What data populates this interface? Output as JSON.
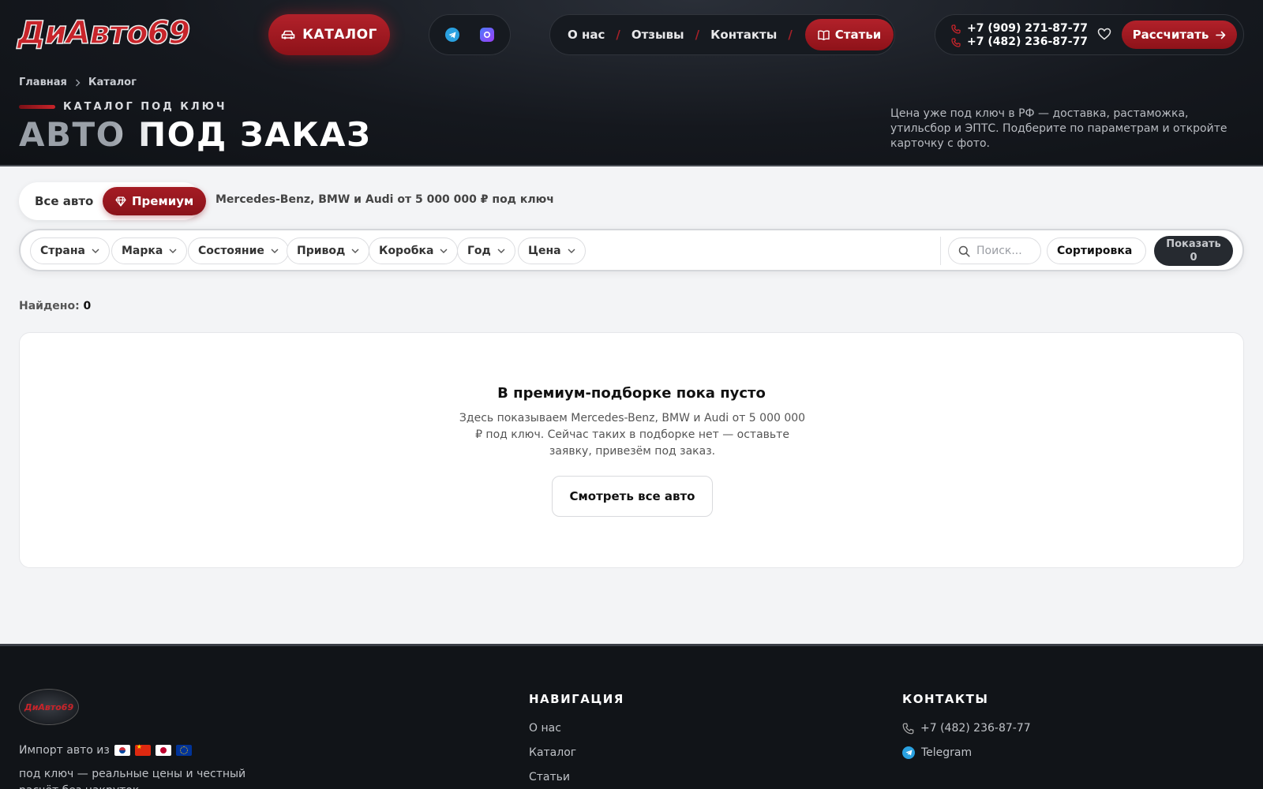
{
  "header": {
    "logo_text": "ДиАвто69",
    "catalog_button": "КАТАЛОГ",
    "social": [
      {
        "icon": "telegram-icon"
      },
      {
        "icon": "max-messenger-icon"
      }
    ],
    "nav": [
      "О нас",
      "Отзывы",
      "Контакты"
    ],
    "nav_articles": "Статьи",
    "phones": [
      "+7 (909) 271-87-77",
      "+7 (482) 236-87-77"
    ],
    "calc_button": "Рассчитать"
  },
  "hero": {
    "breadcrumb": [
      "Главная",
      "Каталог"
    ],
    "eyebrow": "КАТАЛОГ ПОД КЛЮЧ",
    "title": "АВТО ПОД ЗАКАЗ",
    "description": "Цена уже под ключ в РФ — доставка, растаможка, утильсбор и ЭПТС. Подберите по параметрам и откройте карточку с фото."
  },
  "tabs": {
    "all": "Все авто",
    "premium": "Премиум",
    "premium_note": "Mercedes-Benz, BMW и Audi от 5 000 000 ₽ под ключ"
  },
  "filters": {
    "chips": [
      "Страна",
      "Марка",
      "Состояние",
      "Привод",
      "Коробка",
      "Год",
      "Цена"
    ],
    "search_placeholder": "Поиск...",
    "sort_label": "Сортировка",
    "show_label": "Показать",
    "show_count": "0"
  },
  "results": {
    "found_label": "Найдено:",
    "found_count": "0"
  },
  "empty": {
    "title": "В премиум-подборке пока пусто",
    "text": "Здесь показываем Mercedes-Benz, BMW и Audi от 5 000 000 ₽ под ключ. Сейчас таких в подборке нет — оставьте заявку, привезём под заказ.",
    "button": "Смотреть все авто"
  },
  "footer": {
    "logo_text": "ДиАвто69",
    "import_label": "Импорт авто из",
    "flags": [
      "south-korea-flag",
      "china-flag",
      "japan-flag",
      "eu-flag"
    ],
    "tagline": "под ключ — реальные цены и честный расчёт без накруток.",
    "nav_heading": "НАВИГАЦИЯ",
    "nav_links": [
      "О нас",
      "Каталог",
      "Статьи"
    ],
    "contacts_heading": "КОНТАКТЫ",
    "contact_phone": "+7 (482) 236-87-77",
    "contact_telegram": "Telegram"
  },
  "colors": {
    "accent": "#b2212a",
    "dark_bg": "#15181e",
    "page_bg": "#f3f4f6"
  }
}
